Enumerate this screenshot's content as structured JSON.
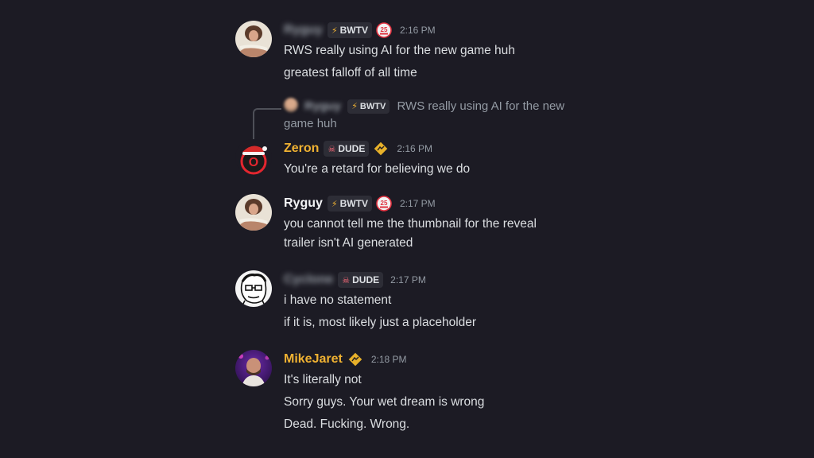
{
  "messages": [
    {
      "username": "Ryguy",
      "tag": "BWTV",
      "time": "2:16 PM",
      "lines": [
        "RWS really using AI for the new game huh",
        "greatest falloff of all time"
      ]
    },
    {
      "reply": {
        "username": "Ryguy",
        "tag": "BWTV",
        "text": "RWS really using AI for the new game huh"
      },
      "username": "Zeron",
      "username_color": "#f0b232",
      "tag": "DUDE",
      "time": "2:16 PM",
      "lines": [
        "You're a retard for believing we do"
      ]
    },
    {
      "username": "Ryguy",
      "tag": "BWTV",
      "time": "2:17 PM",
      "lines": [
        "you cannot tell me the thumbnail for the reveal",
        "trailer isn't AI generated"
      ]
    },
    {
      "username": "Cyclone",
      "tag": "DUDE",
      "time": "2:17 PM",
      "lines": [
        "i have no statement",
        "if it is, most likely just a placeholder"
      ]
    },
    {
      "username": "MikeJaret",
      "username_color": "#f0b232",
      "time": "2:18 PM",
      "lines": [
        "It's literally not",
        "Sorry guys. Your wet dream is wrong",
        "Dead. Fucking. Wrong."
      ]
    }
  ],
  "icons": {
    "bwtv_tag": "lightning-bolt-icon",
    "dude_tag": "skull-icon",
    "twenty_five_badge": "anniversary-badge-icon",
    "diamond_badge": "diamond-sign-badge-icon"
  },
  "colors": {
    "background": "#1c1b24",
    "text": "#dbdee1",
    "muted": "#949ba4",
    "gold_username": "#f0b232"
  }
}
